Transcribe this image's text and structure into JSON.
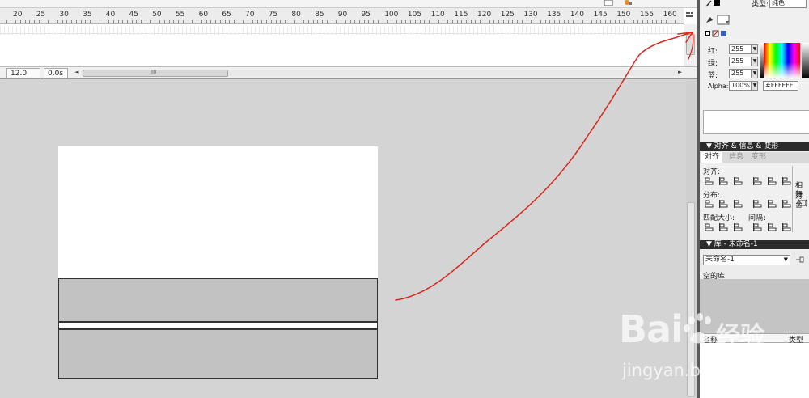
{
  "timeline": {
    "ruler_labels": [
      "20",
      "25",
      "30",
      "35",
      "40",
      "45",
      "50",
      "55",
      "60",
      "65",
      "70",
      "75",
      "80",
      "85",
      "90",
      "95",
      "100",
      "105",
      "110",
      "115",
      "120",
      "125",
      "130",
      "135",
      "140",
      "145",
      "150",
      "155",
      "160"
    ],
    "fps": "12.0 fps",
    "elapsed": "0.0s",
    "scroll_grip": "III"
  },
  "properties_strip": {
    "type_label": "类型:",
    "type_value": "纯色"
  },
  "color_mixer": {
    "red_label": "红:",
    "red_value": "255",
    "green_label": "绿:",
    "green_value": "255",
    "blue_label": "蓝:",
    "blue_value": "255",
    "alpha_label": "Alpha:",
    "alpha_value": "100%",
    "hex_value": "#FFFFFF"
  },
  "align_panel": {
    "header": "▼ 对齐 & 信息 & 变形",
    "tabs": [
      "对齐",
      "信息",
      "变形"
    ],
    "align_label": "对齐:",
    "distribute_label": "分布:",
    "match_size_label": "匹配大小:",
    "spacing_label": "间隔:",
    "relative_label_1": "相对",
    "relative_label_2": "舞台"
  },
  "library_panel": {
    "header": "▼ 库 - 未命名-1",
    "selected_library": "未命名-1",
    "empty_label": "空的库",
    "col_name": "名称",
    "col_type": "类型"
  },
  "watermark": {
    "brand": "Bai",
    "brand_cn": "经验",
    "url": "jingyan.baidu.com"
  },
  "colors": {
    "stage_bg": "#d4d4d4",
    "rect_fill": "#c2c2c2",
    "annotation": "#d9261c",
    "panel_header": "#2b2b2b"
  }
}
